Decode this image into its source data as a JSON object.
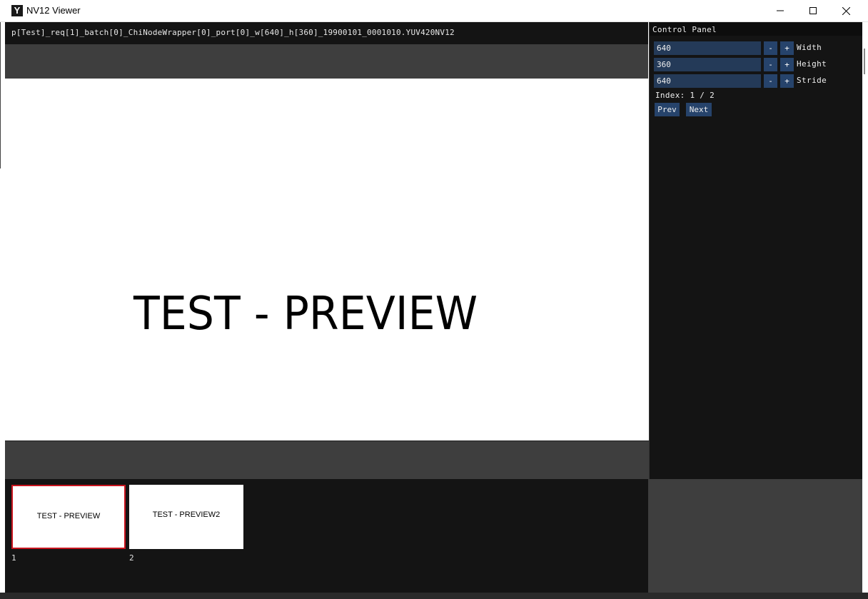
{
  "window": {
    "logo": "Y",
    "title": "NV12 Viewer"
  },
  "file": {
    "name": "p[Test]_req[1]_batch[0]_ChiNodeWrapper[0]_port[0]_w[640]_h[360]_19900101_0001010.YUV420NV12"
  },
  "preview": {
    "text": "TEST - PREVIEW"
  },
  "thumbnails": [
    {
      "label": "TEST - PREVIEW",
      "index": "1",
      "selected": true
    },
    {
      "label": "TEST - PREVIEW2",
      "index": "2",
      "selected": false
    }
  ],
  "panel": {
    "title": "Control Panel",
    "fields": [
      {
        "label": "Width",
        "value": "640"
      },
      {
        "label": "Height",
        "value": "360"
      },
      {
        "label": "Stride",
        "value": "640"
      }
    ],
    "minus_label": "-",
    "plus_label": "+",
    "index_text": "Index: 1 / 2",
    "prev_label": "Prev",
    "next_label": "Next"
  },
  "colors": {
    "selection_border": "#c8141e",
    "field_bg": "#243a58",
    "button_bg": "#26436b",
    "panel_bg": "#141414",
    "band_bg": "#3e3e3e"
  },
  "icons": [
    "app-logo-icon",
    "minimize-icon",
    "maximize-icon",
    "close-icon"
  ]
}
